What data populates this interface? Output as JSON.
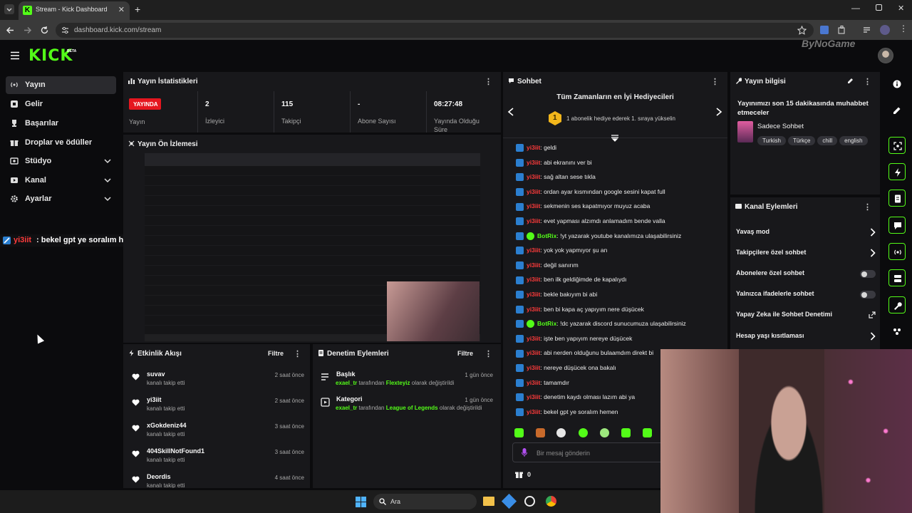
{
  "browser": {
    "tab_title": "Stream - Kick Dashboard",
    "url": "dashboard.kick.com/stream",
    "watermark": "ByNoGame"
  },
  "header": {
    "logo": "KICK",
    "beta": "BETA"
  },
  "sidebar": {
    "items": [
      {
        "label": "Yayın"
      },
      {
        "label": "Gelir"
      },
      {
        "label": "Başarılar"
      },
      {
        "label": "Droplar ve ödüller"
      },
      {
        "label": "Stüdyo"
      },
      {
        "label": "Kanal"
      },
      {
        "label": "Ayarlar"
      }
    ]
  },
  "overlay_chat": {
    "user": "yi3iit",
    "message": ": bekel gpt ye soralım hemen"
  },
  "stats": {
    "title": "Yayın İstatistikleri",
    "live_badge": "YAYINDA",
    "live_label": "Yayın",
    "viewers_value": "2",
    "viewers_label": "İzleyici",
    "followers_value": "115",
    "followers_label": "Takipçi",
    "subs_value": "-",
    "subs_label": "Abone Sayısı",
    "duration_value": "08:27:48",
    "duration_label_1": "Yayında Olduğu",
    "duration_label_2": "Süre"
  },
  "preview": {
    "title": "Yayın Ön İzlemesi"
  },
  "activity": {
    "title": "Etkinlik Akışı",
    "filter": "Filtre",
    "items": [
      {
        "name": "suvav",
        "sub": "kanalı takip etti",
        "time": "2 saat önce"
      },
      {
        "name": "yi3iit",
        "sub": "kanalı takip etti",
        "time": "2 saat önce"
      },
      {
        "name": "xGokdeniz44",
        "sub": "kanalı takip etti",
        "time": "3 saat önce"
      },
      {
        "name": "404SkillNotFound1",
        "sub": "kanalı takip etti",
        "time": "3 saat önce"
      },
      {
        "name": "Deordis",
        "sub": "kanalı takip etti",
        "time": "4 saat önce"
      }
    ]
  },
  "moderation": {
    "title": "Denetim Eylemleri",
    "filter": "Filtre",
    "items": [
      {
        "title": "Başlık",
        "user": "exael_tr",
        "mid": " tarafından ",
        "value": "Flexteyiz",
        "end": " olarak değiştirildi",
        "time": "1 gün önce"
      },
      {
        "title": "Kategori",
        "user": "exael_tr",
        "mid": " tarafından ",
        "value": "League of Legends",
        "end": " olarak değiştirildi",
        "time": "1 gün önce"
      }
    ]
  },
  "chat": {
    "title": "Sohbet",
    "gifters_title": "Tüm Zamanların en İyi Hediyecileri",
    "gifters_rank": "1",
    "gifters_text": "1 abonelik hediye ederek 1. sıraya yükselin",
    "messages": [
      {
        "user": "yi3iit",
        "text": ": geldi"
      },
      {
        "user": "yi3iit",
        "text": ": abi ekranını ver bi"
      },
      {
        "user": "yi3iit",
        "text": ": sağ altan sese tıkla"
      },
      {
        "user": "yi3iit",
        "text": ": ordan ayar kısmından google sesini kapat full"
      },
      {
        "user": "yi3iit",
        "text": ": sekmenin ses kapatmıyor muyuz acaba"
      },
      {
        "user": "yi3iit",
        "text": ": evet yapması alzımdı anlamadım bende valla"
      },
      {
        "user": "BotRix",
        "text": ": !yt yazarak youtube kanalımıza ulaşabilirsiniz",
        "bot": true
      },
      {
        "user": "yi3iit",
        "text": ": yok yok yapmıyor şu an"
      },
      {
        "user": "yi3iit",
        "text": ": değil sanırım"
      },
      {
        "user": "yi3iit",
        "text": ": ben ilk geldiğimde de kapalıydı"
      },
      {
        "user": "yi3iit",
        "text": ": bekle bakıyım bi abi"
      },
      {
        "user": "yi3iit",
        "text": ": ben bi kapa aç yapıyım nere düşücek"
      },
      {
        "user": "BotRix",
        "text": ": !dc yazarak discord sunucumuza ulaşabilirsiniz",
        "bot": true
      },
      {
        "user": "yi3iit",
        "text": ": işte ben yapıyım nereye düşücek"
      },
      {
        "user": "yi3iit",
        "text": ": abi nerden olduğunu bulaamdım direkt bi"
      },
      {
        "user": "yi3iit",
        "text": ": nereye düşücek ona bakalı"
      },
      {
        "user": "yi3iit",
        "text": ": tamamdır"
      },
      {
        "user": "yi3iit",
        "text": ": denetim kaydı olması lazım abi ya"
      },
      {
        "user": "yi3iit",
        "text": ": bekel gpt ye soralım hemen"
      }
    ],
    "input_placeholder": "Bir mesaj gönderin",
    "count": "0"
  },
  "stream_info": {
    "title": "Yayın bilgisi",
    "stream_title": "Yayınımızı son 15 dakikasında muhabbet etmeceler",
    "category": "Sadece Sohbet",
    "tags": [
      "Turkish",
      "Türkçe",
      "chill",
      "english"
    ]
  },
  "channel_actions": {
    "title": "Kanal Eylemleri",
    "items": [
      {
        "label": "Yavaş mod",
        "kind": "arrow"
      },
      {
        "label": "Takipçilere özel sohbet",
        "kind": "arrow"
      },
      {
        "label": "Abonelere özel sohbet",
        "kind": "toggle"
      },
      {
        "label": "Yalnızca ifadelerle sohbet",
        "kind": "toggle"
      },
      {
        "label": "Yapay Zeka ile Sohbet Denetimi",
        "kind": "external"
      },
      {
        "label": "Hesap yaşı kısıtlaması",
        "kind": "arrow"
      }
    ]
  },
  "taskbar": {
    "search": "Ara"
  },
  "colors": {
    "accent": "#53fc18",
    "live": "#e5161f",
    "panel": "#18181b",
    "bg": "#0b0b0d",
    "username": "#ff3b3b"
  }
}
